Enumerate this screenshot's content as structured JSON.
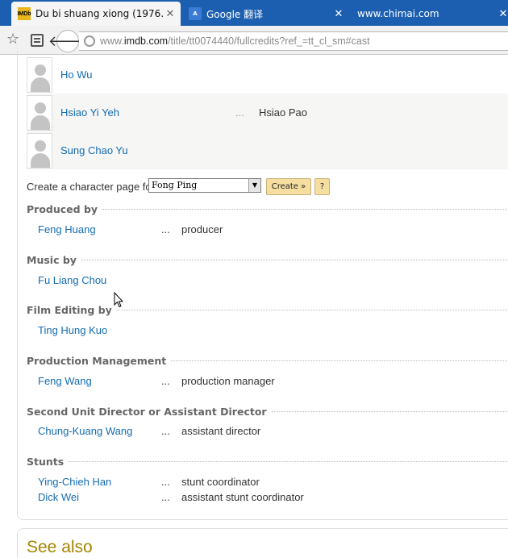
{
  "tabs": [
    {
      "title": "Du bi shuang xiong (1976...",
      "favicon": "imdb-icon",
      "favicon_text": "IMDb",
      "active": true
    },
    {
      "title": "Google 翻译",
      "favicon": "google-translate-icon",
      "favicon_text": "A",
      "active": false
    },
    {
      "title": "www.chimai.com",
      "favicon": "",
      "active": false
    }
  ],
  "toolbar": {
    "url_prefix": "www.",
    "url_host": "imdb.com",
    "url_path": "/title/tt0074440/fullcredits?ref_=tt_cl_sm#cast"
  },
  "cast": [
    {
      "name": "Ho Wu",
      "ellipsis": "",
      "character": ""
    },
    {
      "name": "Hsiao Yi Yeh",
      "ellipsis": "...",
      "character": "Hsiao Pao"
    },
    {
      "name": "Sung Chao Yu",
      "ellipsis": "",
      "character": ""
    }
  ],
  "character_page": {
    "label": "Create a character page for:",
    "selected": "Fong Ping",
    "create_label": "Create »",
    "help_label": "?"
  },
  "sections": [
    {
      "title": "Produced by",
      "credits": [
        {
          "name": "Feng Huang",
          "ellipsis": "...",
          "role": "producer"
        }
      ]
    },
    {
      "title": "Music by",
      "credits": [
        {
          "name": "Fu Liang Chou",
          "ellipsis": "",
          "role": ""
        }
      ]
    },
    {
      "title": "Film Editing by",
      "credits": [
        {
          "name": "Ting Hung Kuo",
          "ellipsis": "",
          "role": ""
        }
      ]
    },
    {
      "title": "Production Management",
      "credits": [
        {
          "name": "Feng Wang",
          "ellipsis": "...",
          "role": "production manager"
        }
      ]
    },
    {
      "title": "Second Unit Director or Assistant Director",
      "credits": [
        {
          "name": "Chung-Kuang Wang",
          "ellipsis": "...",
          "role": "assistant director"
        }
      ]
    },
    {
      "title": "Stunts",
      "credits": [
        {
          "name": "Ying-Chieh Han",
          "ellipsis": "...",
          "role": "stunt coordinator"
        },
        {
          "name": "Dick Wei",
          "ellipsis": "...",
          "role": "assistant stunt coordinator"
        }
      ]
    }
  ],
  "see_also": {
    "title": "See also"
  },
  "colors": {
    "tabstrip": "#1c5fb0",
    "link": "#136cb2",
    "see_also": "#a58500",
    "button": "#f5dea0"
  }
}
